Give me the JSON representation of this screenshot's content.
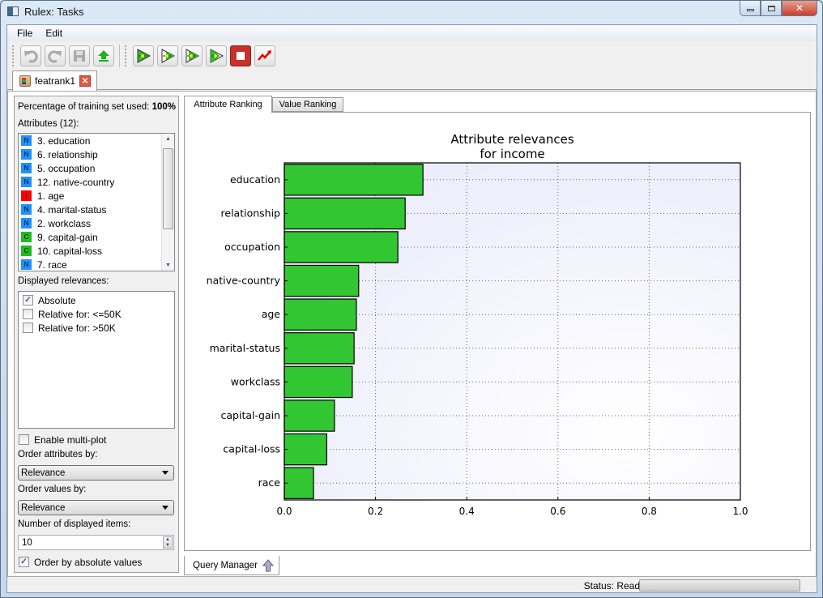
{
  "window": {
    "title": "Rulex: Tasks",
    "minimize": "—",
    "maximize": "▫",
    "close": "✕"
  },
  "menu": [
    "File",
    "Edit"
  ],
  "toolbar": {
    "buttons": [
      "undo-icon",
      "redo-icon",
      "save-icon",
      "upload-icon",
      "run-all-icon",
      "run-step-icon",
      "run-from-icon",
      "run-to-icon",
      "stop-icon",
      "plot-icon"
    ]
  },
  "doc_tab": {
    "label": "featrank1"
  },
  "left": {
    "training_label": "Percentage of training set used:",
    "training_value": "100%",
    "attributes_label": "Attributes (12):",
    "attributes": [
      {
        "type": "N",
        "label": "3. education"
      },
      {
        "type": "N",
        "label": "6. relationship"
      },
      {
        "type": "N",
        "label": "5. occupation"
      },
      {
        "type": "N",
        "label": "12. native-country"
      },
      {
        "type": "I",
        "label": "1. age"
      },
      {
        "type": "N",
        "label": "4. marital-status"
      },
      {
        "type": "N",
        "label": "2. workclass"
      },
      {
        "type": "C",
        "label": "9. capital-gain"
      },
      {
        "type": "C",
        "label": "10. capital-loss"
      },
      {
        "type": "N",
        "label": "7. race"
      }
    ],
    "type_colors": {
      "N": "#1e90ff",
      "I": "#ff0000",
      "C": "#22bb22"
    },
    "relevances_label": "Displayed relevances:",
    "relevances": [
      {
        "label": "Absolute",
        "checked": true
      },
      {
        "label": "Relative for: <=50K",
        "checked": false
      },
      {
        "label": "Relative for: >50K",
        "checked": false
      }
    ],
    "multiplot_label": "Enable multi-plot",
    "multiplot_checked": false,
    "order_attr_label": "Order attributes by:",
    "order_attr_value": "Relevance",
    "order_values_label": "Order values by:",
    "order_values_value": "Relevance",
    "num_items_label": "Number of displayed items:",
    "num_items_value": "10",
    "abs_order_label": "Order by absolute values",
    "abs_order_checked": true
  },
  "tabs": [
    {
      "label": "Attribute Ranking",
      "active": true
    },
    {
      "label": "Value Ranking",
      "active": false
    }
  ],
  "query_manager": {
    "label": "Query Manager"
  },
  "status": {
    "text": "Status: Ready",
    "progress": 0
  },
  "chart_data": {
    "type": "bar",
    "orientation": "horizontal",
    "title": "Attribute relevances\nfor income",
    "title_lines": [
      "Attribute relevances",
      "for income"
    ],
    "categories": [
      "education",
      "relationship",
      "occupation",
      "native-country",
      "age",
      "marital-status",
      "workclass",
      "capital-gain",
      "capital-loss",
      "race"
    ],
    "values": [
      0.304,
      0.265,
      0.249,
      0.163,
      0.158,
      0.153,
      0.149,
      0.11,
      0.093,
      0.064
    ],
    "xlim": [
      0,
      1.0
    ],
    "xticks": [
      "0.0",
      "0.2",
      "0.4",
      "0.6",
      "0.8",
      "1.0"
    ],
    "xlabel": "",
    "ylabel": "",
    "grid": true,
    "bar_color": "#33c633",
    "legend": "none"
  }
}
